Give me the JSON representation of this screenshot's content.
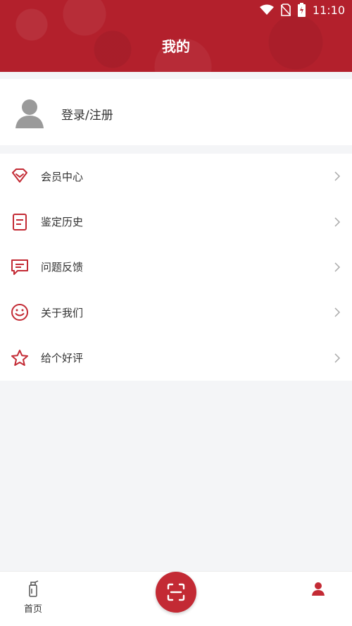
{
  "status_bar": {
    "time": "11:10"
  },
  "header": {
    "title": "我的"
  },
  "user": {
    "login_label": "登录/注册"
  },
  "menu": {
    "items": [
      {
        "label": "会员中心",
        "icon": "diamond-icon"
      },
      {
        "label": "鉴定历史",
        "icon": "document-icon"
      },
      {
        "label": "问题反馈",
        "icon": "chat-icon"
      },
      {
        "label": "关于我们",
        "icon": "smiley-icon"
      },
      {
        "label": "给个好评",
        "icon": "star-icon"
      }
    ]
  },
  "bottom_nav": {
    "home_label": "首页",
    "scan_icon": "scan-icon",
    "mine_icon": "user-icon"
  },
  "colors": {
    "brand": "#b3202c",
    "icon": "#c32a34",
    "background": "#f4f5f7"
  }
}
